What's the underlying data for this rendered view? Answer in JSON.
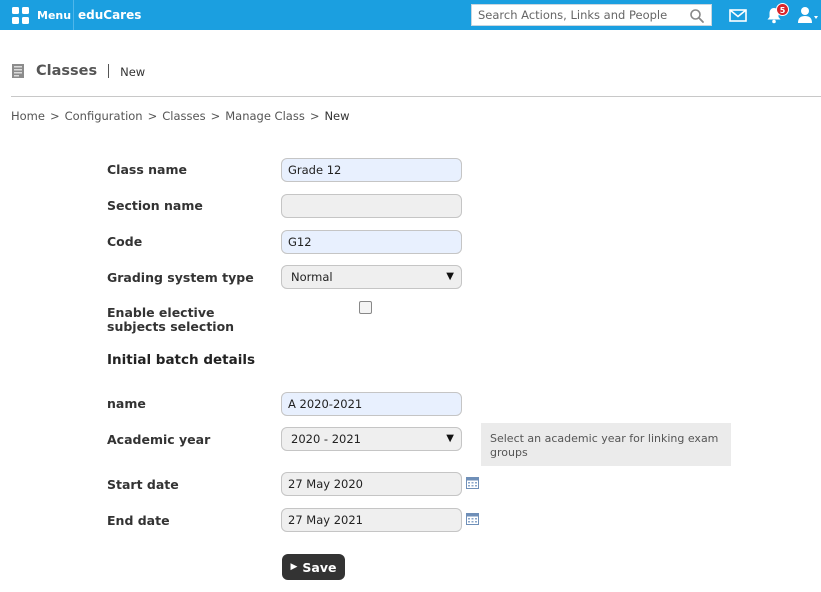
{
  "topbar": {
    "menu_label": "Menu",
    "brand": "eduCares",
    "search_placeholder": "Search Actions, Links and People",
    "notification_count": "5",
    "bar_color": "#1b9fe0"
  },
  "page": {
    "title": "Classes",
    "subtitle": "New",
    "icon": "document-icon"
  },
  "breadcrumb": [
    "Home",
    "Configuration",
    "Classes",
    "Manage Class",
    "New"
  ],
  "form": {
    "class_name_label": "Class name",
    "class_name_value": "Grade 12",
    "section_name_label": "Section name",
    "section_name_value": "",
    "code_label": "Code",
    "code_value": "G12",
    "grading_label": "Grading system type",
    "grading_value": "Normal",
    "elective_label": "Enable elective subjects selection",
    "elective_checked": false,
    "batch_title": "Initial batch details",
    "batch_name_label": "name",
    "batch_name_value": "A 2020-2021",
    "academic_year_label": "Academic year",
    "academic_year_value": "2020 - 2021",
    "academic_year_hint": "Select an academic year for linking exam groups",
    "start_date_label": "Start date",
    "start_date_value": "27 May 2020",
    "end_date_label": "End date",
    "end_date_value": "27 May 2021",
    "save_label": "Save"
  }
}
